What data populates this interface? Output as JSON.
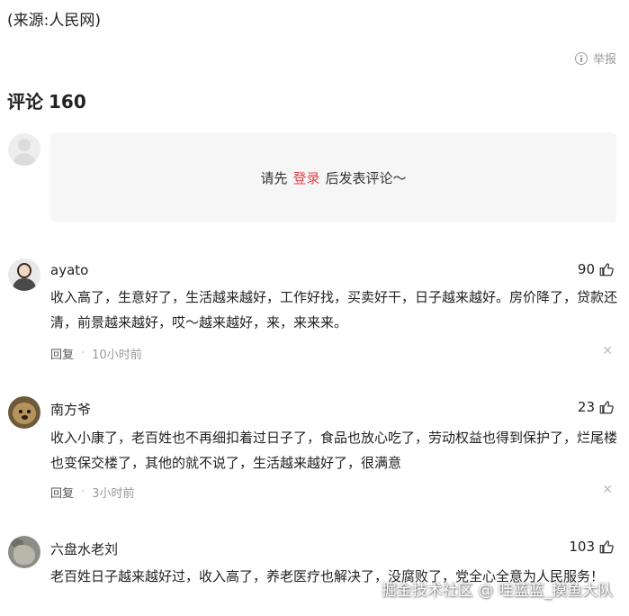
{
  "source": "(来源:人民网)",
  "report": {
    "label": "举报",
    "icon": "info-icon"
  },
  "comments_header": {
    "label": "评论",
    "count": "160"
  },
  "login_prompt": {
    "before": "请先",
    "link": "登录",
    "after": "后发表评论～"
  },
  "comments": [
    {
      "name": "ayato",
      "likes": "90",
      "text": "收入高了，生意好了，生活越来越好，工作好找，买卖好干，日子越来越好。房价降了，贷款还清，前景越来越好，哎～越来越好，来，来来来。",
      "reply_label": "回复",
      "time": "10小时前"
    },
    {
      "name": "南方爷",
      "likes": "23",
      "text": "收入小康了，老百姓也不再细扣着过日子了，食品也放心吃了，劳动权益也得到保护了，烂尾楼也变保交楼了，其他的就不说了，生活越来越好了，很满意",
      "reply_label": "回复",
      "time": "3小时前"
    },
    {
      "name": "六盘水老刘",
      "likes": "103",
      "text": "老百姓日子越来越好过，收入高了，养老医疗也解决了，没腐败了，党全心全意为人民服务！"
    }
  ],
  "watermark": "掘金技术社区 @ 哇蓝蓝_摸鱼大队",
  "colors": {
    "accent": "#e0464c",
    "meta": "#999999",
    "box_bg": "#f6f6f6"
  }
}
